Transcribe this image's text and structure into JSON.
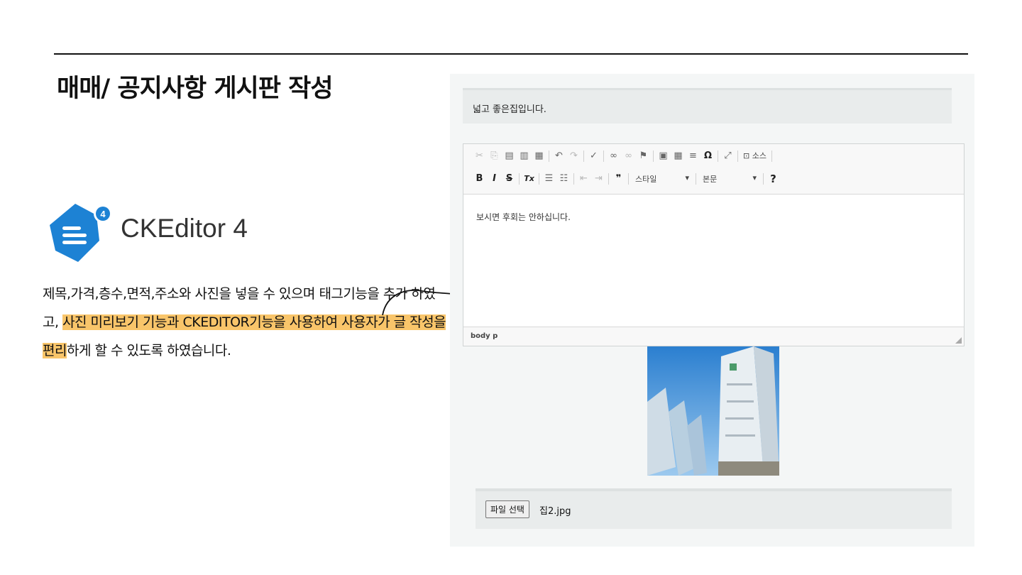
{
  "slide": {
    "title": "매매/ 공지사항 게시판 작성",
    "description_plain_1": "제목,가격,층수,면적,주소와 사진을 넣을 수 있으며 태그기능을 추가 하였고, ",
    "description_highlight": "사진 미리보기 기능과 CKEDITOR기능을 사용하여 사용자가 글 작성을편리",
    "description_plain_2": "하게 할 수 있도록 하였습니다.",
    "highlight_color": "#f9c56a"
  },
  "logo": {
    "name": "CKEditor 4",
    "badge": "4",
    "brand_color": "#1d82d4"
  },
  "form": {
    "title_value": "넓고 좋은집입니다.",
    "editor": {
      "toolbar_row1": [
        "cut-icon",
        "copy-icon",
        "paste-icon",
        "paste-text-icon",
        "paste-word-icon",
        "undo-icon",
        "redo-icon",
        "spellcheck-icon",
        "link-icon",
        "unlink-icon",
        "anchor-icon",
        "image-icon",
        "table-icon",
        "horizontal-rule-icon",
        "special-char-icon",
        "maximize-icon",
        "source-icon"
      ],
      "source_label": "소스",
      "special_char_glyph": "Ω",
      "bold": "B",
      "italic": "I",
      "strike": "S",
      "remove_format": "Tx",
      "blockquote_glyph": "❞",
      "style_label": "스타일",
      "format_label": "본문",
      "help_label": "?",
      "content": "보시면 후회는 안하십니다.",
      "status_path": "body  p"
    },
    "file_button": "파일 선택",
    "file_name": "집2.jpg"
  }
}
